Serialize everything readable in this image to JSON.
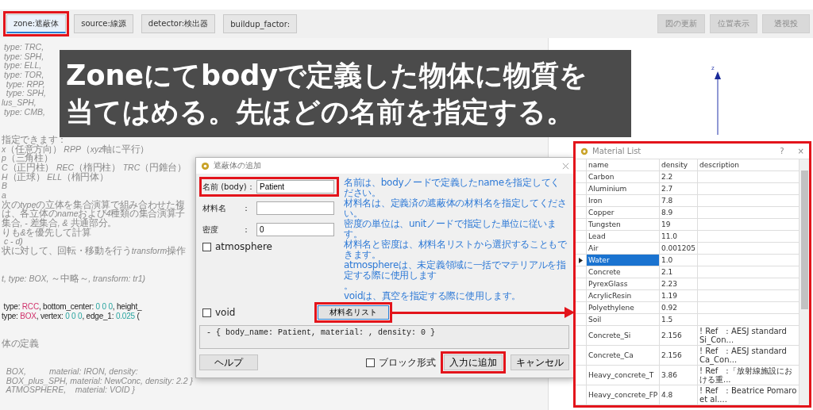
{
  "toolbar": {
    "tabs": [
      {
        "label": "zone:遮蔽体",
        "selected": true,
        "highlighted": true
      },
      {
        "label": "source:線源",
        "selected": false,
        "highlighted": false
      },
      {
        "label": "detector:検出器",
        "selected": false,
        "highlighted": false
      },
      {
        "label": "buildup_factor:",
        "selected": false,
        "highlighted": false
      }
    ],
    "view_buttons": [
      "図の更新",
      "位置表示",
      "透視投"
    ]
  },
  "editor": {
    "lines": [
      {
        "kind": "comment",
        "text": " type: TRC,"
      },
      {
        "kind": "comment",
        "text": " type: SPH,"
      },
      {
        "kind": "comment",
        "text": " type: ELL,"
      },
      {
        "kind": "comment",
        "text": " type: TOR,"
      },
      {
        "kind": "comment",
        "text": "  type: RPP,"
      },
      {
        "kind": "comment",
        "text": "  type: SPH,"
      },
      {
        "kind": "comment",
        "text": "lus_SPH,"
      },
      {
        "kind": "comment",
        "text": " type: CMB,"
      },
      {
        "kind": "blank"
      },
      {
        "kind": "blank"
      },
      {
        "kind": "comment",
        "text": "指定できます："
      },
      {
        "kind": "comment",
        "text": "x（任意方向） RPP（xyz軸に平行）"
      },
      {
        "kind": "comment",
        "text": "p（三角柱）"
      },
      {
        "kind": "comment",
        "text": "C（正円柱） REC（楕円柱） TRC（円錐台）"
      },
      {
        "kind": "comment",
        "text": "H（正球） ELL（楕円体）"
      },
      {
        "kind": "comment",
        "text": "B"
      },
      {
        "kind": "comment",
        "text": "a"
      },
      {
        "kind": "comment",
        "text": "次のtypeの立体を集合演算で組み合わせた複"
      },
      {
        "kind": "comment",
        "text": "は、各立体のnameおよび4種類の集合演算子"
      },
      {
        "kind": "comment",
        "text": "集合, - 差集合, & 共通部分。"
      },
      {
        "kind": "comment",
        "text": "りも&を優先して計算"
      },
      {
        "kind": "comment",
        "text": " c - d)"
      },
      {
        "kind": "comment",
        "text": "状に対して、回転・移動を行うtransform操作"
      },
      {
        "kind": "blank"
      },
      {
        "kind": "blank"
      },
      {
        "kind": "comment",
        "text": "t, type: BOX, ～中略～, transform: tr1)"
      },
      {
        "kind": "blank"
      },
      {
        "kind": "blank"
      },
      {
        "kind": "code",
        "segments": [
          {
            "text": " type: ",
            "kind": "key"
          },
          {
            "text": "RCC",
            "kind": "value"
          },
          {
            "text": ", bottom_center: ",
            "kind": "key"
          },
          {
            "text": "0 0 0",
            "kind": "number"
          },
          {
            "text": ", height_",
            "kind": "key"
          }
        ]
      },
      {
        "kind": "code",
        "segments": [
          {
            "text": "type: ",
            "kind": "key"
          },
          {
            "text": "BOX",
            "kind": "value"
          },
          {
            "text": ", vertex: ",
            "kind": "key"
          },
          {
            "text": "0 0 0",
            "kind": "number"
          },
          {
            "text": ", edge_1: ",
            "kind": "key"
          },
          {
            "text": "0.025",
            "kind": "number"
          },
          {
            "text": " (",
            "kind": "key"
          }
        ]
      },
      {
        "kind": "blank"
      },
      {
        "kind": "blank"
      },
      {
        "kind": "comment",
        "text": "体の定義"
      },
      {
        "kind": "blank"
      },
      {
        "kind": "blank"
      },
      {
        "kind": "comment",
        "text": "  BOX,          material: IRON, density:"
      },
      {
        "kind": "comment",
        "text": "  BOX_plus_SPH, material: NewConc, density: 2.2 }"
      },
      {
        "kind": "comment",
        "text": "  ATMOSPHERE,    material: VOID }"
      }
    ]
  },
  "callout": {
    "lines": [
      "Zoneにてbodyで定義した物体に物質を",
      "当てはめる。先ほどの名前を指定する。"
    ]
  },
  "view": {
    "axis_label": "z"
  },
  "dialog": {
    "title": "遮蔽体の追加",
    "fields": [
      {
        "label": "名前 (body)：",
        "value": "Patient",
        "highlighted": true
      },
      {
        "label": "材料名　　：",
        "highlighted": false
      },
      {
        "label": "密度　　　：",
        "value": "0",
        "highlighted": false
      }
    ],
    "checkboxes": [
      {
        "label": "atmosphere",
        "checked": false
      },
      {
        "label": "void",
        "checked": false
      }
    ],
    "list_button": {
      "label": "材料名リスト",
      "highlighted": true
    },
    "help_lines": [
      "名前は、bodyノードで定義したnameを指定してください。",
      "材料名は、定義済の遮蔽体の材料名を指定してください。",
      "密度の単位は、unitノードで指定した単位に従います。",
      "材料名と密度は、材料名リストから選択することもできます。",
      "atmosphereは、未定義領域に一括でマテリアルを指定する際に使用します",
      "。",
      "voidは、真空を指定する際に使用します。"
    ],
    "preview": "- { body_name: Patient, material: , density: 0 }",
    "help_button": "ヘルプ",
    "block_checkbox": {
      "label": "ブロック形式",
      "checked": false
    },
    "add_button": {
      "label": "入力に追加",
      "highlighted": true
    },
    "cancel_button": "キャンセル"
  },
  "material_list": {
    "title": "Material List",
    "help": "?",
    "close": "×",
    "highlighted": true,
    "columns": [
      "name",
      "density",
      "description"
    ],
    "rows": [
      {
        "name": "Carbon",
        "density": "2.2",
        "selected": false
      },
      {
        "name": "Aluminium",
        "density": "2.7",
        "selected": false
      },
      {
        "name": "Iron",
        "density": "7.8",
        "selected": false
      },
      {
        "name": "Copper",
        "density": "8.9",
        "selected": false
      },
      {
        "name": "Tungsten",
        "density": "19",
        "selected": false
      },
      {
        "name": "Lead",
        "density": "11.0",
        "selected": false
      },
      {
        "name": "Air",
        "density": "0.001205",
        "selected": false
      },
      {
        "name": "Water",
        "density": "1.0",
        "selected": true
      },
      {
        "name": "Concrete",
        "density": "2.1",
        "selected": false
      },
      {
        "name": "PyrexGlass",
        "density": "2.23",
        "selected": false
      },
      {
        "name": "AcrylicResin",
        "density": "1.19",
        "selected": false
      },
      {
        "name": "Polyethylene",
        "density": "0.92",
        "selected": false
      },
      {
        "name": "Soil",
        "density": "1.5",
        "selected": false
      },
      {
        "name": "Concrete_Si",
        "density": "2.156",
        "description": "! Ref　: AESJ standard Si_Con...",
        "selected": false
      },
      {
        "name": "Concrete_Ca",
        "density": "2.156",
        "description": "! Ref　: AESJ standard Ca_Con...",
        "selected": false
      },
      {
        "name": "Heavy_concrete_T",
        "density": "3.86",
        "description": "! Ref　:「放射線施設における重...",
        "selected": false
      },
      {
        "name": "Heavy_concrete_FP",
        "density": "4.8",
        "description": "! Ref　: Beatrice Pomaro et al....",
        "selected": false
      }
    ]
  }
}
